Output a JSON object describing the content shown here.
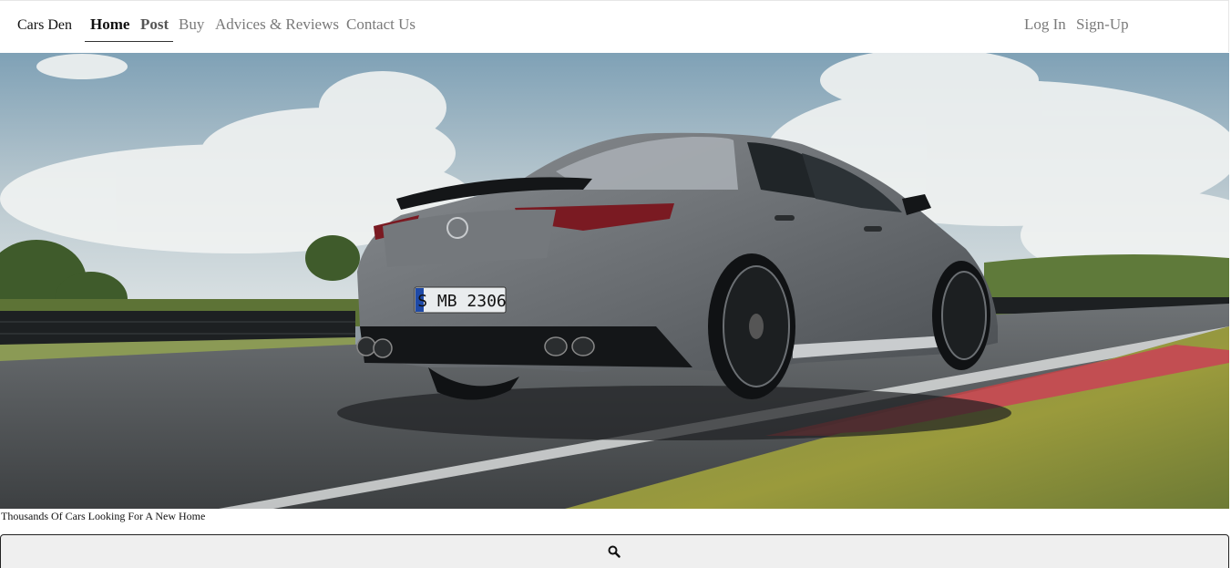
{
  "navbar": {
    "brand": "Cars Den",
    "links": [
      {
        "label": "Home",
        "active": true
      },
      {
        "label": "Post"
      },
      {
        "label": "Buy"
      },
      {
        "label": "Advices & Reviews"
      },
      {
        "label": "Contact Us"
      }
    ],
    "auth": {
      "login": "Log In",
      "signup": "Sign-Up"
    }
  },
  "hero": {
    "image": "car-hero-image",
    "license_plate": "S MB 2306",
    "caption": "Thousands Of Cars Looking For A New Home"
  },
  "search": {
    "icon": "search-icon"
  },
  "colors": {
    "nav_active": "#111111",
    "nav_inactive": "#7a7a7a",
    "search_bg": "#efefef",
    "search_border": "#222222"
  }
}
